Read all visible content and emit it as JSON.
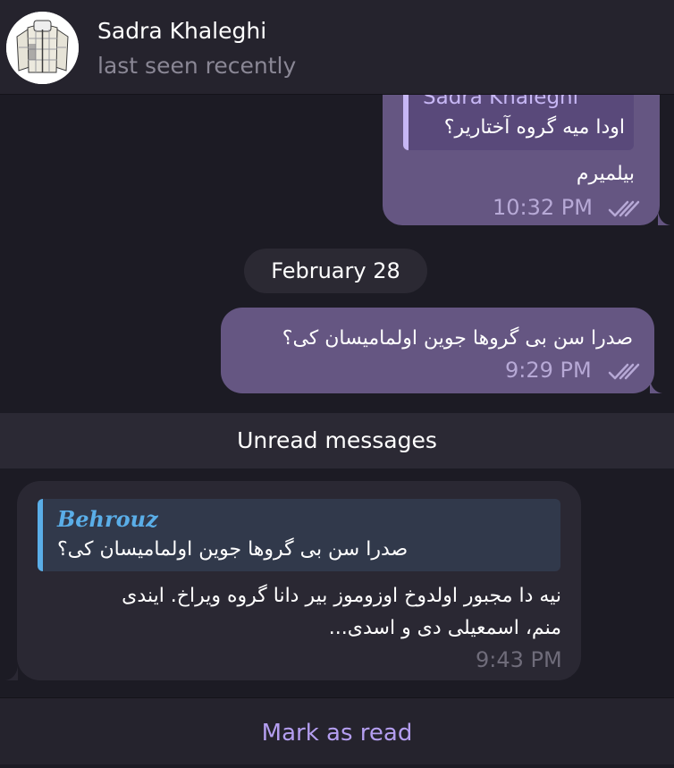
{
  "header": {
    "name": "Sadra Khaleghi",
    "status": "last seen recently"
  },
  "messages": {
    "m1": {
      "reply_author": "Sadra Khaleghi",
      "reply_text": "اودا میه گروه آختاریر؟",
      "text": "بیلمیرم",
      "time": "10:32 PM"
    },
    "date_separator": "February 28",
    "m2": {
      "text": "صدرا سن بی گروها جوین اولمامیسان کی؟",
      "time": "9:29 PM"
    },
    "unread_label": "Unread messages",
    "m3": {
      "reply_author": "Behrouz",
      "reply_text": "صدرا سن بی گروها جوین اولمامیسان کی؟",
      "text_line1": "نیه دا مجبور اولدوخ اوزوموز بیر دانا گروه ویراخ. ایندی",
      "text_line2": "منم، اسمعیلی دی و اسدی...",
      "time": "9:43 PM"
    }
  },
  "footer": {
    "mark_read_label": "Mark as read"
  },
  "colors": {
    "outgoing_bubble": "#655682",
    "incoming_bubble": "#2a2833",
    "accent": "#b49ef0",
    "reply_in_accent": "#5aaee8"
  },
  "icons": {
    "read_status": "double-check-icon",
    "avatar": "jacket-avatar"
  }
}
